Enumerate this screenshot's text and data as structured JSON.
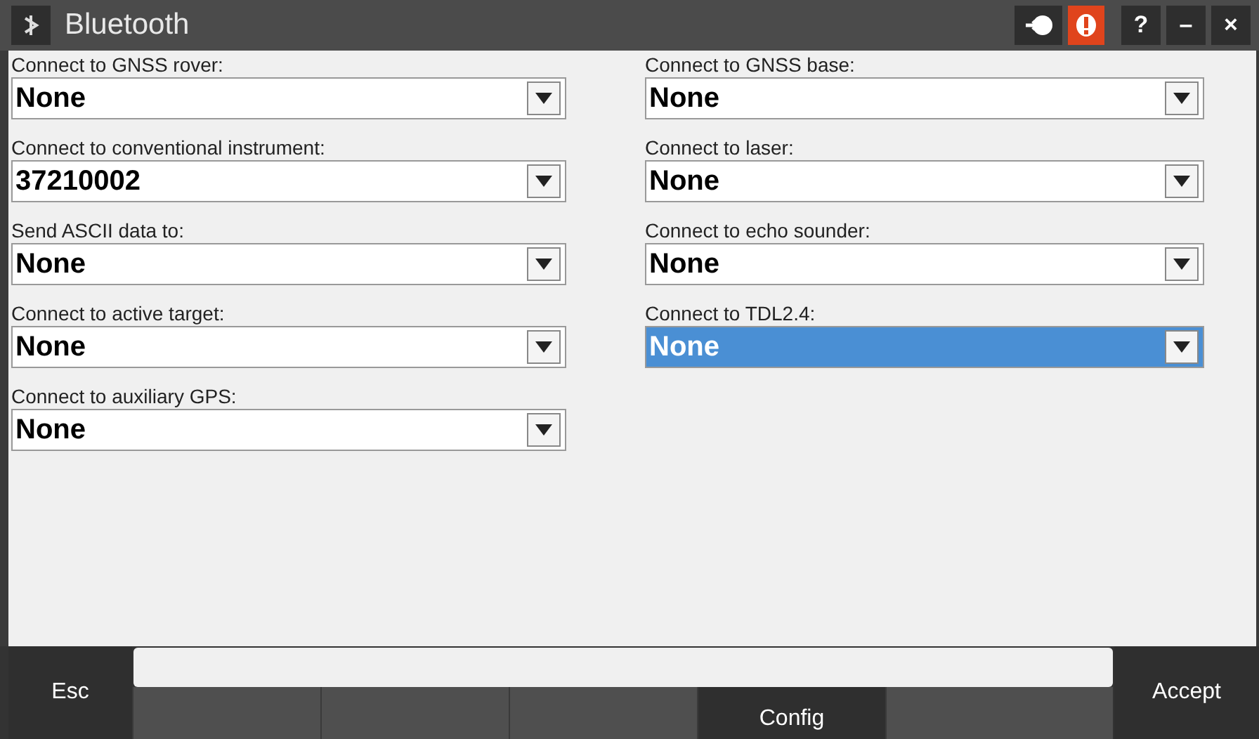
{
  "window": {
    "title": "Bluetooth",
    "buttons": [
      "?",
      "–",
      "×"
    ]
  },
  "fields": [
    {
      "label": "Connect to GNSS rover:",
      "value": "None",
      "selected": false
    },
    {
      "label": "Connect to GNSS base:",
      "value": "None",
      "selected": false
    },
    {
      "label": "Connect to conventional instrument:",
      "value": "37210002",
      "selected": false
    },
    {
      "label": "Connect to laser:",
      "value": "None",
      "selected": false
    },
    {
      "label": "Send ASCII data to:",
      "value": "None",
      "selected": false
    },
    {
      "label": "Connect to echo sounder:",
      "value": "None",
      "selected": false
    },
    {
      "label": "Connect to active target:",
      "value": "None",
      "selected": false
    },
    {
      "label": "Connect to TDL2.4:",
      "value": "None",
      "selected": true
    },
    {
      "label": "Connect to auxiliary GPS:",
      "value": "None",
      "selected": false
    }
  ],
  "footer": {
    "left_button": "Esc",
    "right_button": "Accept",
    "softkeys": [
      {
        "kind": "blank"
      },
      {
        "kind": "blank"
      },
      {
        "kind": "blank"
      },
      {
        "kind": "labeled",
        "label": "Config"
      },
      {
        "kind": "blank"
      }
    ]
  }
}
